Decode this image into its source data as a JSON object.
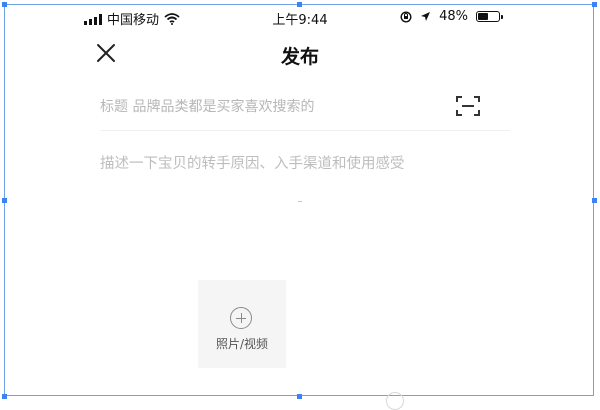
{
  "status_bar": {
    "carrier": "中国移动",
    "time": "上午9:44",
    "battery_percent": "48%"
  },
  "header": {
    "title": "发布",
    "close_icon": "close-icon"
  },
  "form": {
    "title_placeholder": "标题 品牌品类都是买家喜欢搜索的",
    "scan_icon": "scan-icon",
    "description_placeholder": "描述一下宝贝的转手原因、入手渠道和使用感受"
  },
  "media": {
    "add_label": "照片/视频",
    "add_icon": "plus-circle-icon"
  },
  "colors": {
    "selection_border": "#6fa2e6",
    "placeholder_text": "#bdbdbd",
    "media_tile_bg": "#f5f5f5"
  }
}
